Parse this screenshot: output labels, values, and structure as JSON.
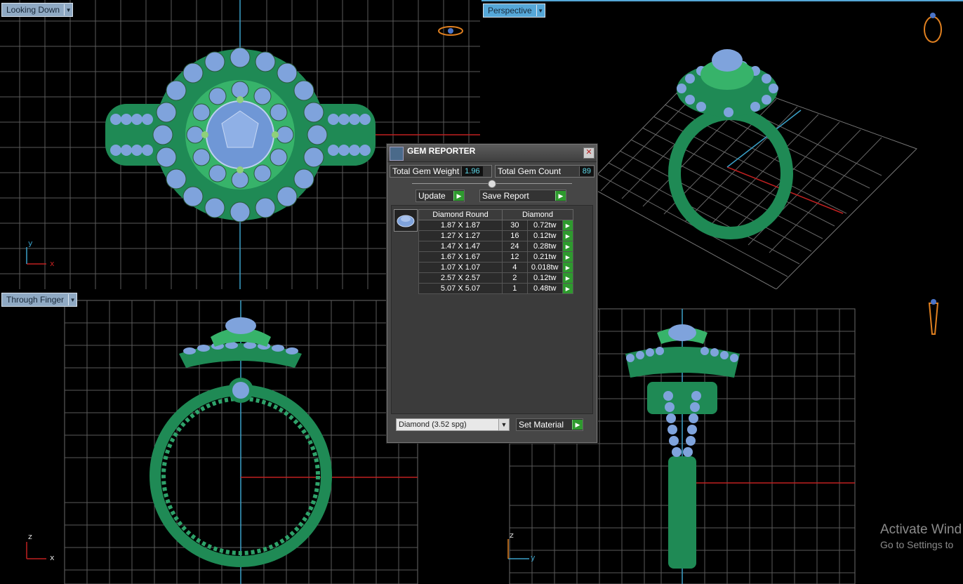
{
  "viewports": {
    "top_left": {
      "label": "Looking Down",
      "axis_1": "y",
      "axis_2": "x"
    },
    "top_right": {
      "label": "Perspective"
    },
    "bottom_left": {
      "label": "Through Finger",
      "axis_1": "z",
      "axis_2": "x"
    },
    "bottom_right": {
      "axis_1": "z",
      "axis_2": "y"
    }
  },
  "gem_reporter": {
    "title": "GEM REPORTER",
    "close": "✕",
    "total_weight_label": "Total Gem Weight",
    "total_weight_value": "1.96",
    "total_count_label": "Total Gem Count",
    "total_count_value": "89",
    "update_label": "Update",
    "save_report_label": "Save Report",
    "table_header_shape": "Diamond Round",
    "table_header_material": "Diamond",
    "rows": [
      {
        "size": "1.87 X 1.87",
        "count": "30",
        "weight": "0.72tw"
      },
      {
        "size": "1.27 X 1.27",
        "count": "16",
        "weight": "0.12tw"
      },
      {
        "size": "1.47 X 1.47",
        "count": "24",
        "weight": "0.28tw"
      },
      {
        "size": "1.67 X 1.67",
        "count": "12",
        "weight": "0.21tw"
      },
      {
        "size": "1.07 X 1.07",
        "count": "4",
        "weight": "0.018tw"
      },
      {
        "size": "2.57 X 2.57",
        "count": "2",
        "weight": "0.12tw"
      },
      {
        "size": "5.07 X 5.07",
        "count": "1",
        "weight": "0.48tw"
      }
    ],
    "material_value": "Diamond    (3.52 spg)",
    "set_material_label": "Set Material"
  },
  "watermark": {
    "line1": "Activate Wind",
    "line2": "Go to Settings to"
  },
  "colors": {
    "metal": "#1f8a55",
    "gem": "#7fa3dc",
    "grid": "#5a5a5a",
    "active_label": "#55a7d8",
    "go_button": "#2e9a2e"
  }
}
